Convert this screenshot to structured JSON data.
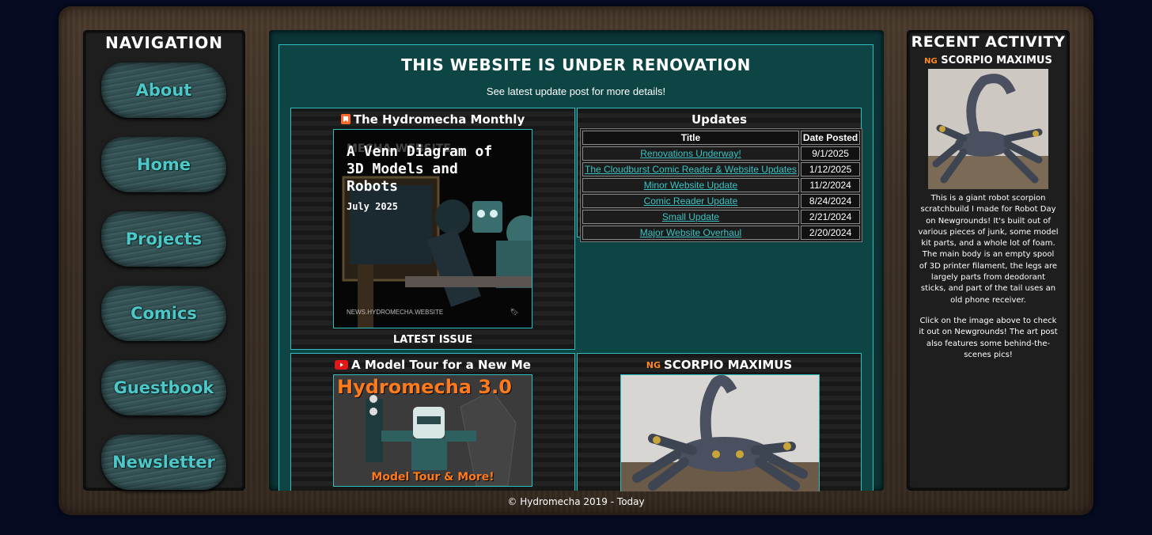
{
  "navigation": {
    "title": "NAVIGATION",
    "items": [
      {
        "label": "About"
      },
      {
        "label": "Home"
      },
      {
        "label": "Projects"
      },
      {
        "label": "Comics"
      },
      {
        "label": "Guestbook"
      },
      {
        "label": "Newsletter"
      }
    ]
  },
  "main": {
    "title": "THIS WEBSITE IS UNDER RENOVATION",
    "subtitle": "See latest update post for more details!",
    "newsletter_card": {
      "title": "The Hydromecha Monthly",
      "icon": "bookmark-icon",
      "issue_heading": "A Venn Diagram of 3D Models and Robots",
      "issue_date": "July 2025",
      "watermark": "MECHA.WEBSITE",
      "footer_url": "NEWS.HYDROMECHA.WEBSITE",
      "caption": "LATEST ISSUE"
    },
    "updates_card": {
      "title": "Updates",
      "columns": [
        "Title",
        "Date Posted"
      ],
      "rows": [
        {
          "title": "Renovations Underway!",
          "date": "9/1/2025"
        },
        {
          "title": "The Cloudburst Comic Reader & Website Updates",
          "date": "1/12/2025"
        },
        {
          "title": "Minor Website Update",
          "date": "11/2/2024"
        },
        {
          "title": "Comic Reader Update",
          "date": "8/24/2024"
        },
        {
          "title": "Small Update",
          "date": "2/21/2024"
        },
        {
          "title": "Major Website Overhaul",
          "date": "2/20/2024"
        }
      ]
    },
    "video_card": {
      "title": "A Model Tour for a New Me",
      "icon": "youtube-icon",
      "thumb_heading": "Hydromecha 3.0",
      "thumb_caption": "Model Tour & More!"
    },
    "art_card": {
      "title": "SCORPIO MAXIMUS",
      "icon": "newgrounds-icon"
    }
  },
  "recent_activity": {
    "title": "RECENT ACTIVITY",
    "item_title": "SCORPIO MAXIMUS",
    "icon": "newgrounds-icon",
    "description": "This is a giant robot scorpion scratchbuild I made for Robot Day on Newgrounds! It's built out of various pieces of junk, some model kit parts, and a whole lot of foam. The main body is an empty spool of 3D printer filament, the legs are largely parts from deodorant sticks, and part of the tail uses an old phone receiver.",
    "description2": "Click on the image above to check it out on Newgrounds! The art post also features some behind-the-scenes pics!"
  },
  "footer": {
    "text": "© Hydromecha 2019 - Today"
  },
  "colors": {
    "accent": "#2ec0c0",
    "nav_text": "#4dc8c8",
    "background": "#070b22",
    "frame": "#3b2f25",
    "orange": "#ff7a1a"
  }
}
